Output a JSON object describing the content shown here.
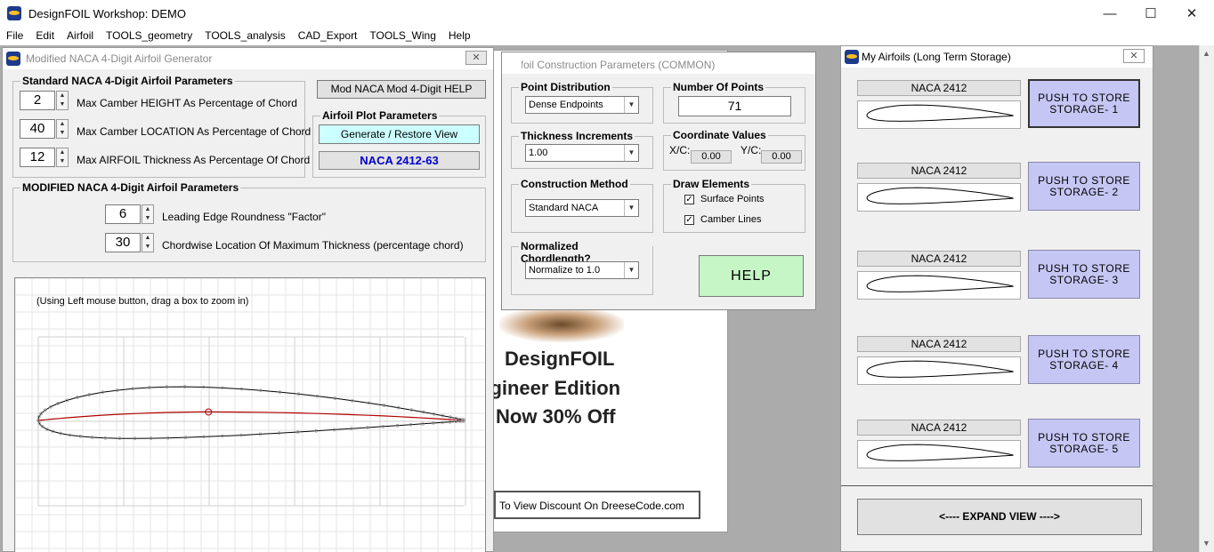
{
  "window": {
    "title": "DesignFOIL Workshop: DEMO",
    "min_glyph": "—",
    "max_glyph": "☐",
    "close_glyph": "✕"
  },
  "menu": [
    "File",
    "Edit",
    "Airfoil",
    "TOOLS_geometry",
    "TOOLS_analysis",
    "CAD_Export",
    "TOOLS_Wing",
    "Help"
  ],
  "naca_gen": {
    "title": "Modified  NACA 4-Digit Airfoil Generator",
    "close_glyph": "✕",
    "std_group": "Standard NACA 4-Digit Airfoil Parameters",
    "camber_height": {
      "value": "2",
      "label": "Max Camber HEIGHT As Percentage of Chord"
    },
    "camber_location": {
      "value": "40",
      "label": "Max Camber LOCATION As Percentage of Chord"
    },
    "thickness": {
      "value": "12",
      "label": "Max AIRFOIL Thickness As Percentage Of Chord"
    },
    "help_btn": "Mod NACA Mod 4-Digit HELP",
    "plot_group": "Airfoil Plot Parameters",
    "generate_btn": "Generate / Restore View",
    "airfoil_name": "NACA 2412-63",
    "mod_group": "MODIFIED  NACA 4-Digit Airfoil Parameters",
    "le_roundness": {
      "value": "6",
      "label": "Leading Edge Roundness \"Factor\""
    },
    "chordwise_loc": {
      "value": "30",
      "label": "Chordwise Location Of Maximum Thickness (percentage chord)"
    },
    "plot_hint": "(Using Left mouse button, drag a box to zoom in)"
  },
  "promo": {
    "line1": "DesignFOIL",
    "line2": "ngineer Edition",
    "line3": "Now 30% Off",
    "discount_btn": "To View Discount On DreeseCode.com"
  },
  "construction": {
    "title": "Airfoil Construction Parameters (COMMON)",
    "point_dist": {
      "label": "Point Distribution",
      "value": "Dense Endpoints"
    },
    "num_points": {
      "label": "Number Of Points",
      "value": "71"
    },
    "thickness_inc": {
      "label": "Thickness Increments",
      "value": "1.00"
    },
    "coord_values": {
      "label": "Coordinate Values",
      "xc_label": "X/C:",
      "xc": "0.00",
      "yc_label": "Y/C:",
      "yc": "0.00"
    },
    "method": {
      "label": "Construction Method",
      "value": "Standard NACA"
    },
    "draw": {
      "label": "Draw Elements",
      "surface": "Surface Points",
      "camber": "Camber Lines",
      "check_glyph": "✓"
    },
    "chord": {
      "label": "Normalized Chordlength?",
      "value": "Normalize to 1.0"
    },
    "help_btn": "HELP"
  },
  "storage": {
    "title": "My Airfoils (Long Term Storage)",
    "close_glyph": "✕",
    "slots": [
      {
        "name": "NACA 2412",
        "button": "PUSH TO STORE\nSTORAGE- 1"
      },
      {
        "name": "NACA 2412",
        "button": "PUSH TO STORE\nSTORAGE- 2"
      },
      {
        "name": "NACA 2412",
        "button": "PUSH TO STORE\nSTORAGE- 3"
      },
      {
        "name": "NACA 2412",
        "button": "PUSH TO STORE\nSTORAGE- 4"
      },
      {
        "name": "NACA 2412",
        "button": "PUSH TO STORE\nSTORAGE- 5"
      }
    ],
    "expand_btn": "<---- EXPAND VIEW ---->"
  },
  "colors": {
    "store_button": "#c6c6f5",
    "generate_button": "#ccffff",
    "help_button": "#c6f5c6",
    "camber_line": "#b00000"
  }
}
